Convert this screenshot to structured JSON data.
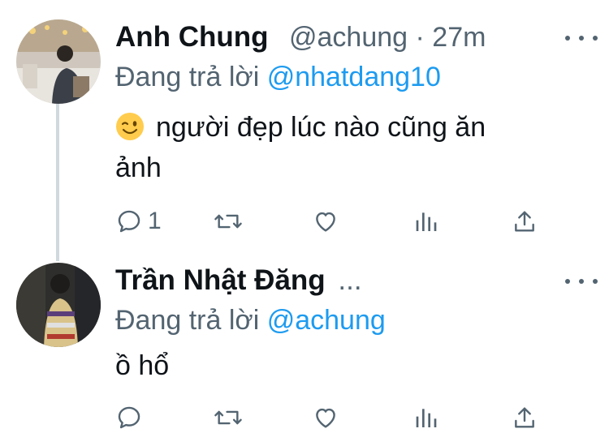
{
  "tweets": [
    {
      "name": "Anh Chung",
      "handle": "@achung",
      "separator": "·",
      "time": "27m",
      "replying_prefix": "Đang trả lời",
      "replying_to": "@nhatdang10",
      "text_line1": "người đẹp lúc nào cũng ăn",
      "text_line2": "ảnh",
      "reply_count": "1"
    },
    {
      "name": "Trần Nhật Đăng",
      "handle_truncated": "...",
      "replying_prefix": "Đang trả lời",
      "replying_to": "@achung",
      "text": "ồ hổ"
    }
  ],
  "colors": {
    "link": "#1d9bf0",
    "muted": "#536471",
    "text": "#0f1419",
    "thread_line": "#cfd9de"
  }
}
